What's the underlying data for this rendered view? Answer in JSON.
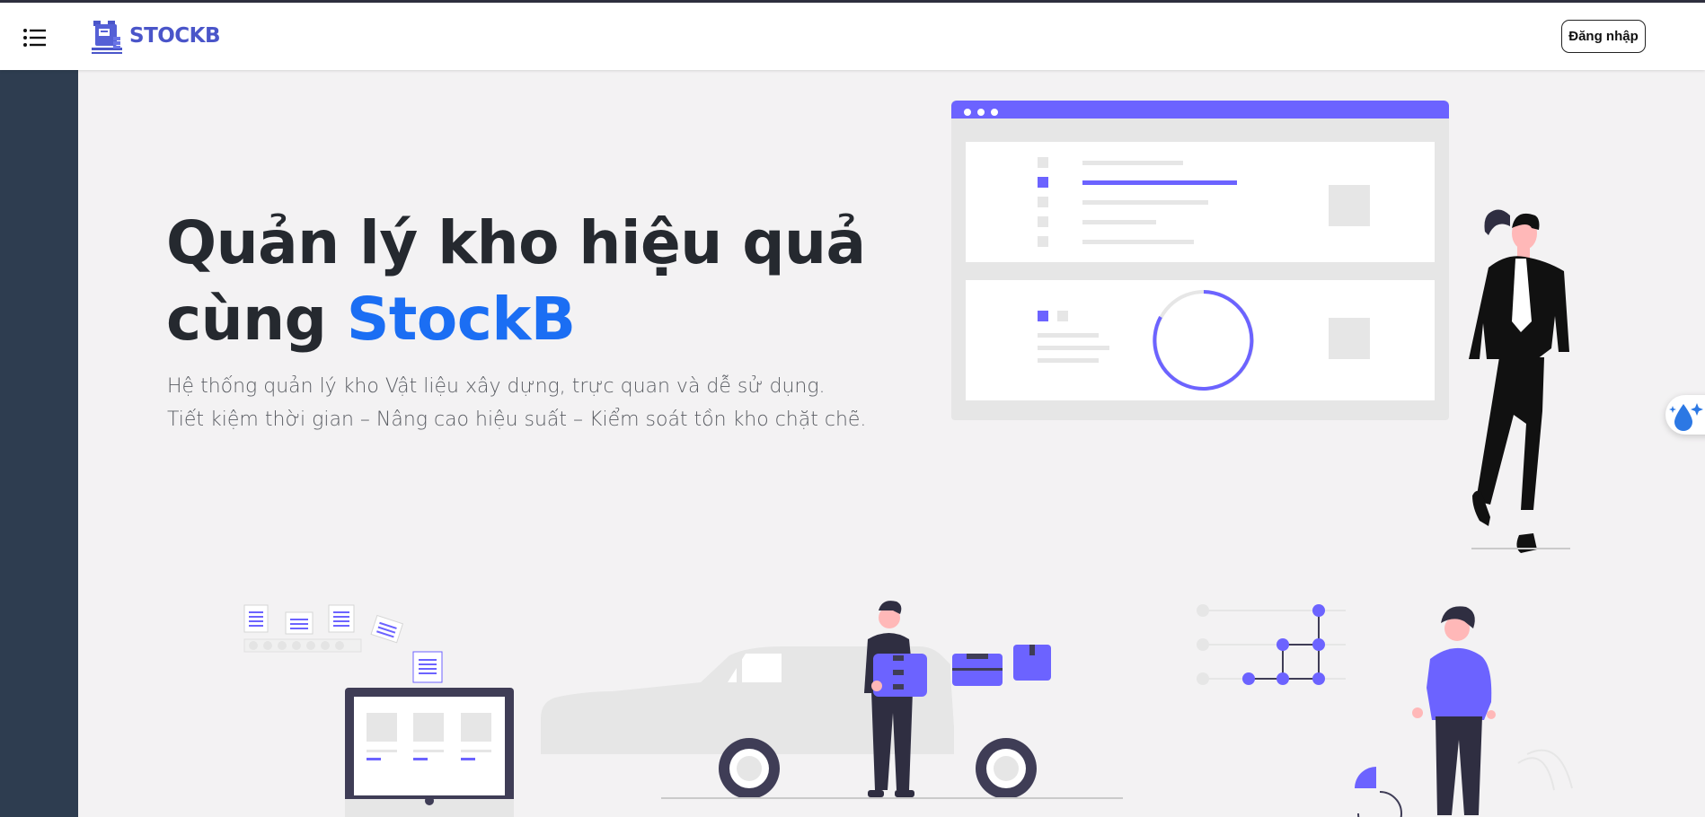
{
  "header": {
    "menu_icon": "list-menu-icon",
    "logo_text": "STOCKB",
    "login_label": "Đăng nhập"
  },
  "hero": {
    "title_line1": "Quản lý kho hiệu quả",
    "title_line2_prefix": "cùng ",
    "title_brand": "StockB",
    "subtitle_line1": "Hệ thống quản lý kho Vật liệu xây dựng, trực quan và dễ sử dụng.",
    "subtitle_line2": "Tiết kiệm thời gian – Nâng cao hiệu suất – Kiểm soát tồn kho chặt chẽ."
  },
  "floating_tool": {
    "icon": "water-drop-sparkle-icon"
  },
  "colors": {
    "accent": "#6c63ff",
    "brand_blue": "#1b6ef3",
    "sidebar": "#2e3d50",
    "title": "#25292f"
  }
}
